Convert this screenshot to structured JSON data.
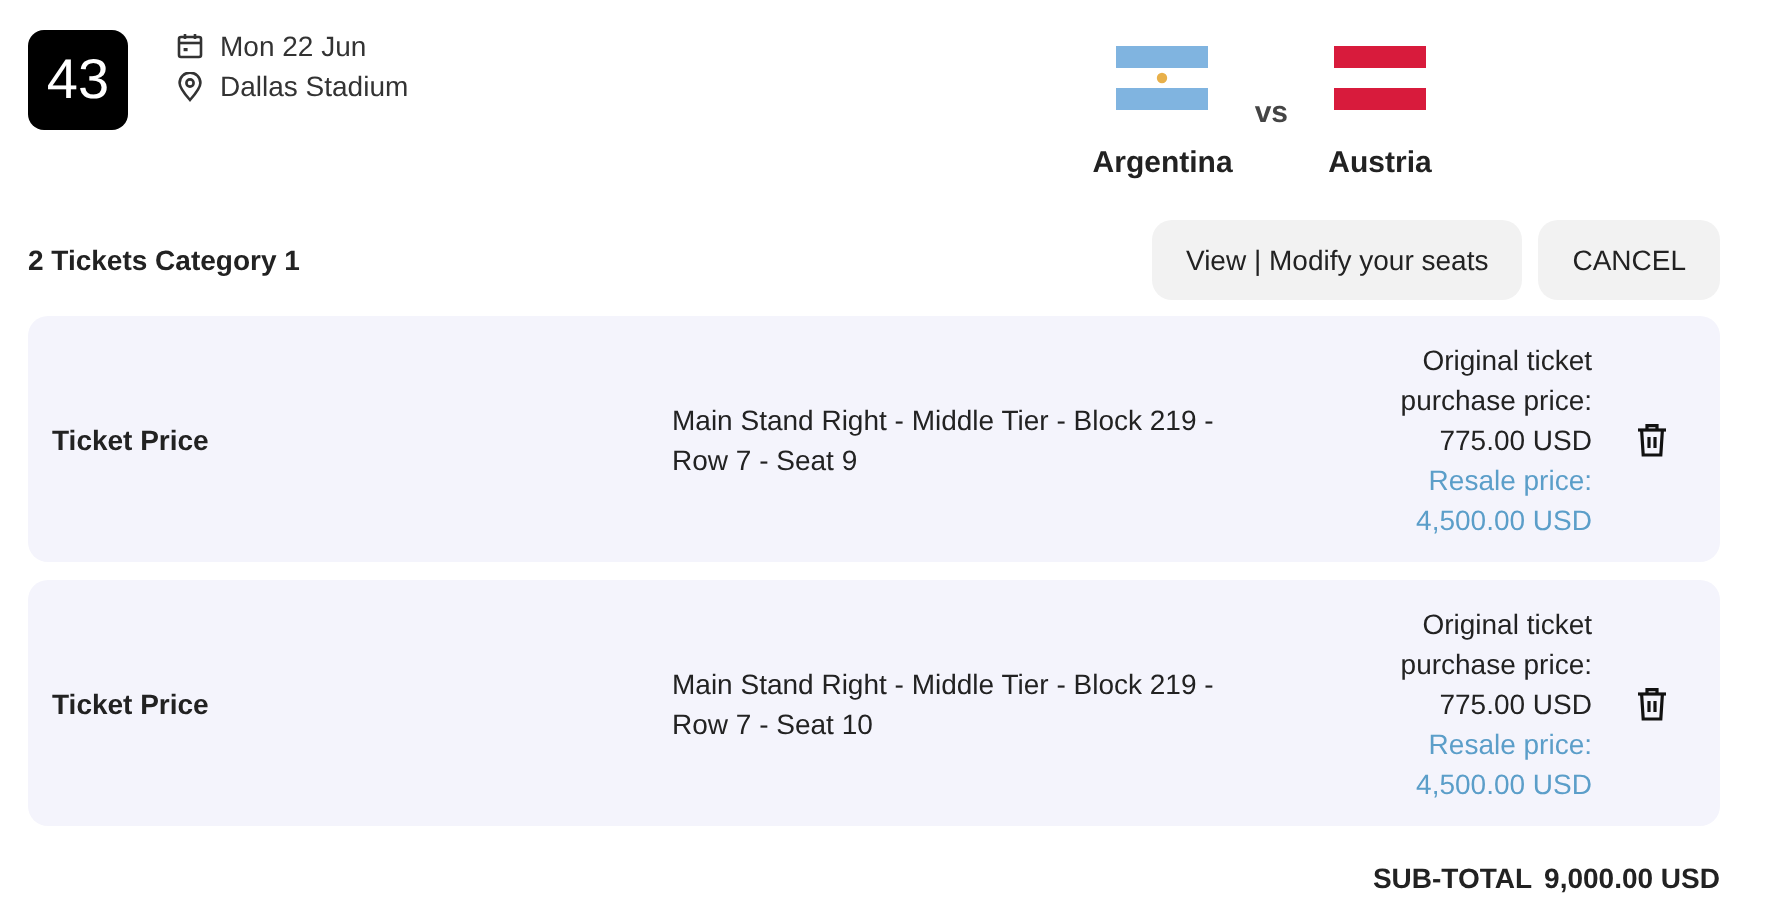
{
  "match": {
    "number": "43",
    "date": "Mon 22 Jun",
    "venue": "Dallas Stadium",
    "vs": "vs",
    "teams": [
      {
        "name": "Argentina",
        "color": "#80b4e0",
        "sun": true
      },
      {
        "name": "Austria",
        "color": "#d81b3c",
        "sun": false
      }
    ]
  },
  "tickets_heading": "2 Tickets Category 1",
  "buttons": [
    {
      "label": "View | Modify your seats"
    },
    {
      "label": "CANCEL"
    }
  ],
  "tickets": [
    {
      "label": "Ticket Price",
      "seat": "Main Stand Right - Middle Tier - Block 219 - Row 7 - Seat 9",
      "original_price": "Original ticket purchase price: 775.00 USD",
      "resale_price": "Resale price: 4,500.00 USD"
    },
    {
      "label": "Ticket Price",
      "seat": "Main Stand Right - Middle Tier - Block 219 - Row 7 - Seat 10",
      "original_price": "Original ticket purchase price: 775.00 USD",
      "resale_price": "Resale price: 4,500.00 USD"
    }
  ],
  "subtotal": {
    "label": "SUB-TOTAL",
    "value": "9,000.00 USD"
  }
}
